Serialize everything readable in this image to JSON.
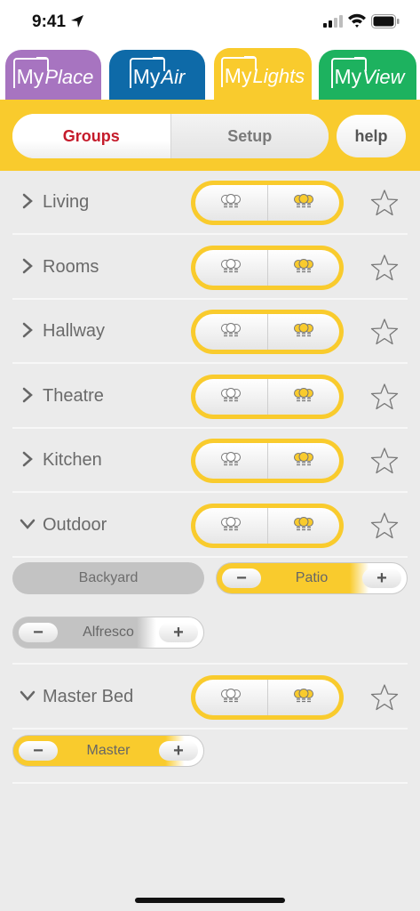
{
  "status_bar": {
    "time": "9:41"
  },
  "app_tabs": [
    {
      "my": "My",
      "name": "Place",
      "color": "#a774c0"
    },
    {
      "my": "My",
      "name": "Air",
      "color": "#0e6aa8"
    },
    {
      "my": "My",
      "name": "Lights",
      "color": "#f9cb2d",
      "active": true
    },
    {
      "my": "My",
      "name": "View",
      "color": "#1db25f"
    }
  ],
  "segment": {
    "groups_label": "Groups",
    "setup_label": "Setup",
    "selected": "Groups"
  },
  "help_label": "help",
  "accent_color": "#f9cb2d",
  "groups": [
    {
      "name": "Living",
      "expanded": false
    },
    {
      "name": "Rooms",
      "expanded": false
    },
    {
      "name": "Hallway",
      "expanded": false
    },
    {
      "name": "Theatre",
      "expanded": false
    },
    {
      "name": "Kitchen",
      "expanded": false
    },
    {
      "name": "Outdoor",
      "expanded": true
    },
    {
      "name": "Master Bed",
      "expanded": true
    }
  ],
  "lights": {
    "backyard": {
      "name": "Backyard",
      "state": "off"
    },
    "patio": {
      "name": "Patio",
      "state": "on",
      "minus": "−",
      "plus": "+"
    },
    "alfresco": {
      "name": "Alfresco",
      "state": "off",
      "minus": "−",
      "plus": "+"
    },
    "master": {
      "name": "Master",
      "state": "on",
      "minus": "−",
      "plus": "+"
    }
  }
}
